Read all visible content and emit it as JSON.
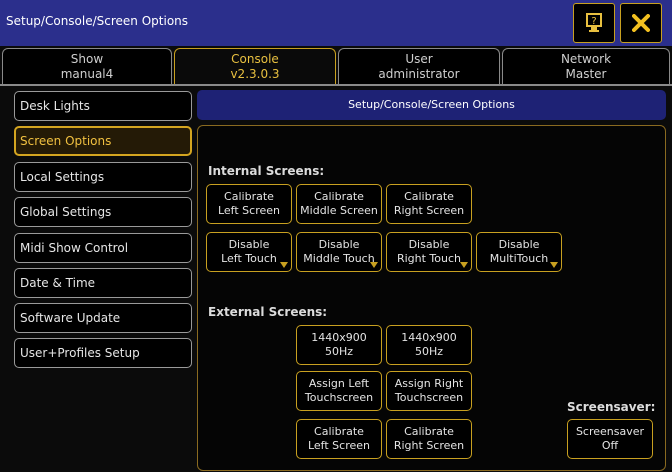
{
  "window": {
    "title": "Setup/Console/Screen Options",
    "help_icon": "help-icon",
    "close_icon": "close-icon"
  },
  "tabs": [
    {
      "line1": "Show",
      "line2": "manual4"
    },
    {
      "line1": "Console",
      "line2": "v2.3.0.3"
    },
    {
      "line1": "User",
      "line2": "administrator"
    },
    {
      "line1": "Network",
      "line2": "Master"
    }
  ],
  "menu": [
    "Desk Lights",
    "Screen Options",
    "Local Settings",
    "Global Settings",
    "Midi Show Control",
    "Date & Time",
    "Software Update",
    "User+Profiles Setup"
  ],
  "panel": {
    "header": "Setup/Console/Screen Options",
    "internal_label": "Internal Screens:",
    "external_label": "External Screens:",
    "screensaver_label": "Screensaver:",
    "calibrate_left": {
      "l1": "Calibrate",
      "l2": "Left Screen"
    },
    "calibrate_middle": {
      "l1": "Calibrate",
      "l2": "Middle Screen"
    },
    "calibrate_right": {
      "l1": "Calibrate",
      "l2": "Right Screen"
    },
    "disable_left": {
      "l1": "Disable",
      "l2": "Left Touch"
    },
    "disable_middle": {
      "l1": "Disable",
      "l2": "Middle Touch"
    },
    "disable_right": {
      "l1": "Disable",
      "l2": "Right Touch"
    },
    "disable_multi": {
      "l1": "Disable",
      "l2": "MultiTouch"
    },
    "ext_res_1": "1440x900 50Hz",
    "ext_res_2": "1440x900 50Hz",
    "assign_left": {
      "l1": "Assign Left",
      "l2": "Touchscreen"
    },
    "assign_right": {
      "l1": "Assign Right",
      "l2": "Touchscreen"
    },
    "ext_cal_left": {
      "l1": "Calibrate",
      "l2": "Left Screen"
    },
    "ext_cal_right": {
      "l1": "Calibrate",
      "l2": "Right Screen"
    },
    "screensaver_btn": "Screensaver Off"
  },
  "colors": {
    "titlebar": "#2b2f8c",
    "accent": "#c8a020",
    "selected_bg": "#241a06"
  }
}
